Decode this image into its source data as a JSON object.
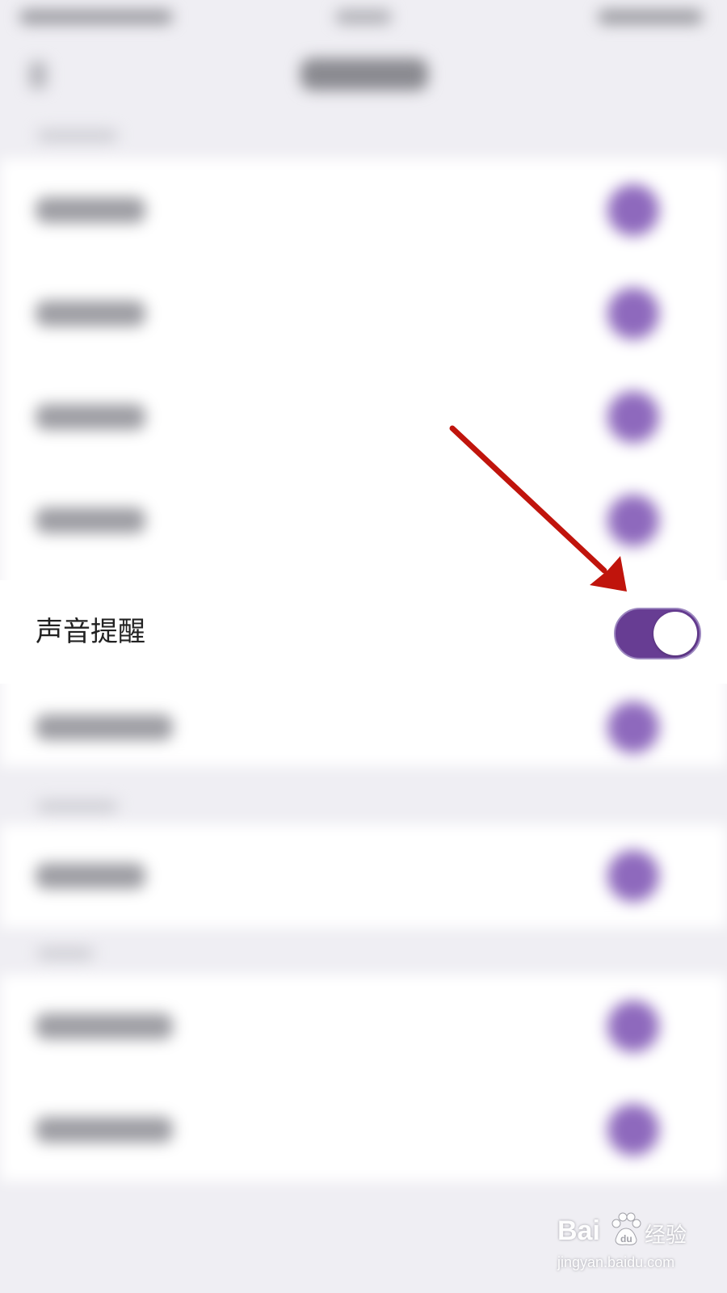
{
  "settings": {
    "sound_alert": {
      "label": "声音提醒",
      "enabled": true
    }
  },
  "colors": {
    "toggle_on": "#673d93",
    "arrow": "#c0140c",
    "background": "#efeef3"
  },
  "watermark": {
    "logo": "Bai",
    "logo_suffix": "经验",
    "url": "jingyan.baidu.com"
  }
}
